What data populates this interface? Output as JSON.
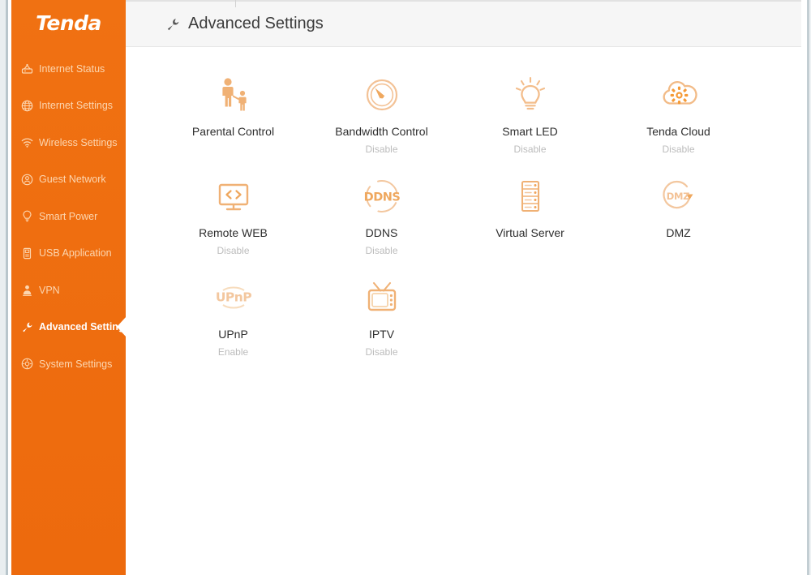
{
  "brand": {
    "logo_text": "Tenda",
    "accent_color": "#ef6c11"
  },
  "sidebar": {
    "items": [
      {
        "label": "Internet Status",
        "icon": "router-icon",
        "active": false
      },
      {
        "label": "Internet Settings",
        "icon": "globe-icon",
        "active": false
      },
      {
        "label": "Wireless Settings",
        "icon": "wifi-icon",
        "active": false
      },
      {
        "label": "Guest Network",
        "icon": "guest-network-icon",
        "active": false
      },
      {
        "label": "Smart Power",
        "icon": "power-bulb-icon",
        "active": false
      },
      {
        "label": "USB Application",
        "icon": "usb-drive-icon",
        "active": false
      },
      {
        "label": "VPN",
        "icon": "vpn-user-icon",
        "active": false
      },
      {
        "label": "Advanced Settings",
        "icon": "wrench-icon",
        "active": true
      },
      {
        "label": "System Settings",
        "icon": "gear-circle-icon",
        "active": false
      }
    ]
  },
  "header": {
    "title": "Advanced Settings",
    "icon": "wrench-icon"
  },
  "main": {
    "tiles": [
      {
        "label": "Parental Control",
        "status": "",
        "icon": "parental-control-icon"
      },
      {
        "label": "Bandwidth Control",
        "status": "Disable",
        "icon": "bandwidth-gauge-icon"
      },
      {
        "label": "Smart LED",
        "status": "Disable",
        "icon": "lightbulb-icon"
      },
      {
        "label": "Tenda Cloud",
        "status": "Disable",
        "icon": "cloud-gear-icon"
      },
      {
        "label": "Remote WEB",
        "status": "Disable",
        "icon": "monitor-code-icon"
      },
      {
        "label": "DDNS",
        "status": "Disable",
        "icon": "ddns-icon"
      },
      {
        "label": "Virtual Server",
        "status": "",
        "icon": "server-rack-icon"
      },
      {
        "label": "DMZ",
        "status": "",
        "icon": "dmz-icon"
      },
      {
        "label": "UPnP",
        "status": "Enable",
        "icon": "upnp-icon"
      },
      {
        "label": "IPTV",
        "status": "Disable",
        "icon": "tv-icon"
      }
    ]
  },
  "colors": {
    "sidebar_orange": "#ef6c11",
    "icon_orange": "#f0b175",
    "label_dark": "#2e2e2e",
    "status_gray": "#bcbcbc",
    "header_bg": "#f6f6f6"
  }
}
